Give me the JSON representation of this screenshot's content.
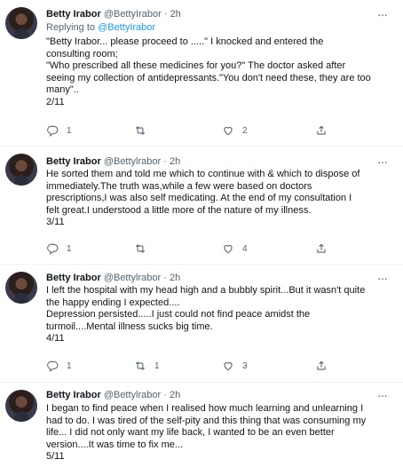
{
  "tweets": [
    {
      "name": "Betty Irabor",
      "handle": "@BettyIrabor",
      "time": "· 2h",
      "replying_prefix": "Replying to ",
      "replying_to": "@BettyIrabor",
      "lines": [
        "\"Betty Irabor... please proceed to .....\" I knocked and entered the",
        "consulting room;",
        "\"Who prescribed all these medicines for you?\" The doctor asked after",
        "seeing my collection of antidepressants.\"You don't need these, they are too",
        "many\"..",
        "2/11"
      ],
      "reply_count": "1",
      "retweet_count": "",
      "like_count": "2"
    },
    {
      "name": "Betty Irabor",
      "handle": "@Bettylrabor",
      "time": "· 2h",
      "lines": [
        "He sorted them and told me which to continue with & which to dispose of",
        "immediately.The truth was,while a few were based on doctors",
        "prescriptions,I was also self medicating. At the end of my consultation I",
        "felt great.I understood a little more of the nature of my illness.",
        "3/11"
      ],
      "reply_count": "1",
      "retweet_count": "",
      "like_count": "4"
    },
    {
      "name": "Betty Irabor",
      "handle": "@Bettylrabor",
      "time": "· 2h",
      "lines": [
        "I left the hospital with my head high and a bubbly spirit...But it wasn't quite",
        "the happy ending I expected....",
        "Depression persisted.....I just could not find peace amidst the",
        "turmoil....Mental illness sucks big time.",
        "4/11"
      ],
      "reply_count": "1",
      "retweet_count": "1",
      "like_count": "3"
    },
    {
      "name": "Betty Irabor",
      "handle": "@Bettylrabor",
      "time": "· 2h",
      "lines": [
        "I began to find peace when I realised how much learning and unlearning I",
        "had to do. I was tired of the self-pity and this thing that was consuming my",
        "life... I did not only want my life back, I wanted to be an even better",
        "version....It was time to fix me...",
        "5/11"
      ],
      "reply_count": "",
      "retweet_count": "",
      "like_count": ""
    }
  ],
  "more_glyph": "···",
  "icons": [
    "reply-icon",
    "retweet-icon",
    "like-icon",
    "share-icon",
    "more-icon",
    "avatar"
  ]
}
